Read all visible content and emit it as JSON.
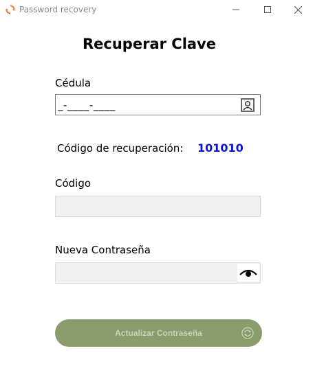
{
  "window": {
    "title": "Password recovery",
    "controls": {
      "minimize": "minimize-icon",
      "maximize": "maximize-icon",
      "close": "close-icon"
    }
  },
  "form": {
    "heading": "Recuperar Clave",
    "cedula": {
      "label": "Cédula",
      "value": "_-____-____",
      "icon": "contact-card-icon"
    },
    "recovery": {
      "label": "Código de recuperación:",
      "code": "101010"
    },
    "codigo": {
      "label": "Código",
      "value": ""
    },
    "password": {
      "label": "Nueva Contraseña",
      "value": "",
      "icon": "eye-icon"
    },
    "submit": {
      "label": "Actualizar Contraseña",
      "icon": "refresh-icon"
    }
  },
  "colors": {
    "accent_code": "#0a14d8",
    "button_bg": "#8b9c6c",
    "button_text": "#c9d2b8",
    "disabled_field": "#f0f0f0"
  }
}
